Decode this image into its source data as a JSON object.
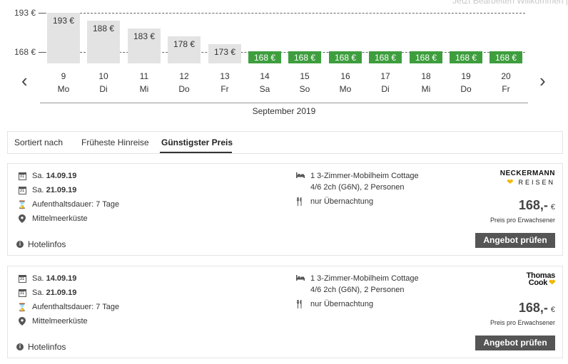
{
  "top_links": "Jetzt Bearbeiten   Willkommen |",
  "chart": {
    "y_labels": [
      "193 €",
      "168 €"
    ],
    "prev_arrow": "‹",
    "next_arrow": "›",
    "month_label": "September 2019"
  },
  "chart_data": {
    "type": "bar",
    "categories": [
      "9 Mo",
      "10 Di",
      "11 Mi",
      "12 Do",
      "13 Fr",
      "14 Sa",
      "15 So",
      "16 Mo",
      "17 Di",
      "18 Mi",
      "19 Do",
      "20 Fr"
    ],
    "values": [
      193,
      188,
      183,
      178,
      173,
      168,
      168,
      168,
      168,
      168,
      168,
      168
    ],
    "ylim": [
      160,
      193
    ],
    "xlabel": "September 2019",
    "reference_lines": [
      193,
      168
    ]
  },
  "days": [
    {
      "num": "9",
      "name": "Mo",
      "price": "193 €",
      "value": 193,
      "status": "grey"
    },
    {
      "num": "10",
      "name": "Di",
      "price": "188 €",
      "value": 188,
      "status": "grey"
    },
    {
      "num": "11",
      "name": "Mi",
      "price": "183 €",
      "value": 183,
      "status": "grey"
    },
    {
      "num": "12",
      "name": "Do",
      "price": "178 €",
      "value": 178,
      "status": "grey"
    },
    {
      "num": "13",
      "name": "Fr",
      "price": "173 €",
      "value": 173,
      "status": "grey"
    },
    {
      "num": "14",
      "name": "Sa",
      "price": "168 €",
      "value": 168,
      "status": "green"
    },
    {
      "num": "15",
      "name": "So",
      "price": "168 €",
      "value": 168,
      "status": "green"
    },
    {
      "num": "16",
      "name": "Mo",
      "price": "168 €",
      "value": 168,
      "status": "green"
    },
    {
      "num": "17",
      "name": "Di",
      "price": "168 €",
      "value": 168,
      "status": "green"
    },
    {
      "num": "18",
      "name": "Mi",
      "price": "168 €",
      "value": 168,
      "status": "green"
    },
    {
      "num": "19",
      "name": "Do",
      "price": "168 €",
      "value": 168,
      "status": "green"
    },
    {
      "num": "20",
      "name": "Fr",
      "price": "168 €",
      "value": 168,
      "status": "green"
    }
  ],
  "colors": {
    "green_bar": "#3e9e3e",
    "grey_bar": "#e3e3e3",
    "button": "#555555",
    "logo_heart": "#f2b600"
  },
  "sort": {
    "label": "Sortiert nach",
    "options": [
      "Früheste Hinreise",
      "Günstigster Preis"
    ],
    "active": "Günstigster Preis"
  },
  "offers": [
    {
      "depart_prefix": "Sa.",
      "depart_date": "14.09.19",
      "return_prefix": "Sa.",
      "return_date": "21.09.19",
      "duration": "Aufenthaltsdauer: 7 Tage",
      "region": "Mittelmeerküste",
      "room_line1": "1 3-Zimmer-Mobilheim Cottage",
      "room_line2": "4/6 2ch (G6N), 2 Personen",
      "board": "nur Übernachtung",
      "price": "168,-",
      "currency": "€",
      "price_note": "Preis pro Erwachsener",
      "button": "Angebot prüfen",
      "hotelinfo": "Hotelinfos",
      "operator": {
        "line1": "NECKERMANN",
        "line2": "REISEN",
        "icon": "heart-icon"
      }
    },
    {
      "depart_prefix": "Sa.",
      "depart_date": "14.09.19",
      "return_prefix": "Sa.",
      "return_date": "21.09.19",
      "duration": "Aufenthaltsdauer: 7 Tage",
      "region": "Mittelmeerküste",
      "room_line1": "1 3-Zimmer-Mobilheim Cottage",
      "room_line2": "4/6 2ch (G6N), 2 Personen",
      "board": "nur Übernachtung",
      "price": "168,-",
      "currency": "€",
      "price_note": "Preis pro Erwachsener",
      "button": "Angebot prüfen",
      "hotelinfo": "Hotelinfos",
      "operator": {
        "line1": "Thomas",
        "line2": "Cook",
        "icon": "heart-icon"
      }
    }
  ],
  "icons": {
    "calendar": "calendar-icon",
    "hourglass": "hourglass-icon",
    "location": "location-pin-icon",
    "bed": "bed-icon",
    "cutlery": "cutlery-icon",
    "info": "info-icon"
  }
}
